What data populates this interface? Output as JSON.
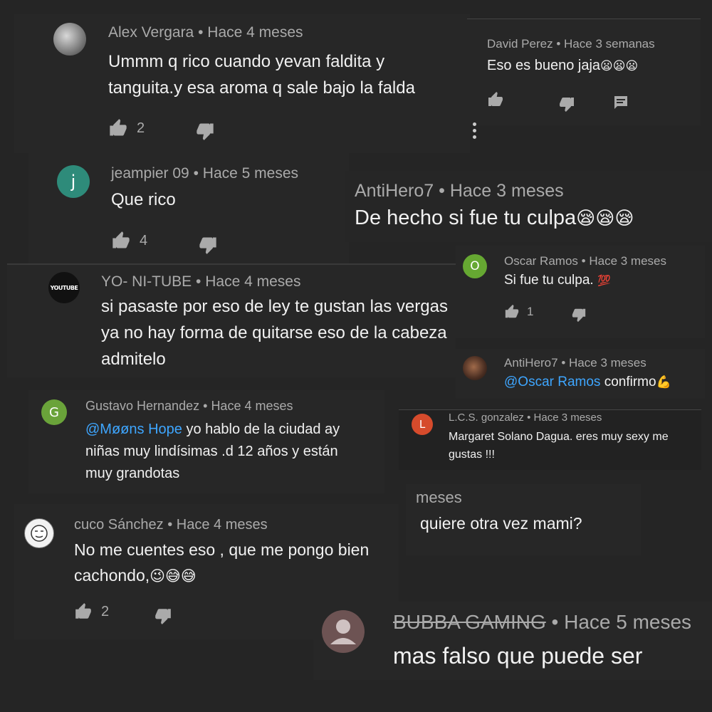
{
  "c1": {
    "author": "Alex Vergara",
    "time": "Hace 4 meses",
    "text": "Ummm q rico cuando yevan faldita y tanguita.y esa aroma q sale bajo la falda",
    "likes": "2"
  },
  "c2": {
    "author": "David Perez",
    "time": "Hace 3 semanas",
    "text": "Eso es bueno jaja",
    "emoji": "😦😦😦"
  },
  "c3": {
    "initial": "j",
    "author": "jeampier 09",
    "time": "Hace 5 meses",
    "text": "Que rico",
    "likes": "4",
    "avatar_color": "#2e8b7a"
  },
  "c4": {
    "author": "AntiHero7",
    "time": "Hace 3 meses",
    "text": "De hecho si fue tu culpa",
    "emoji": "😪😪😪"
  },
  "c5": {
    "avatar_text": "YOUTUBE",
    "author": "YO- NI-TUBE",
    "time": "Hace 4 meses",
    "text": "si pasaste por eso de ley te gustan las vergas ya no hay forma de quitarse eso de la cabeza admitelo"
  },
  "c6": {
    "initial": "O",
    "author": "Oscar Ramos",
    "time": "Hace 3 meses",
    "text": "Si fue tu culpa.",
    "emoji": "💯",
    "likes": "1",
    "avatar_color": "#66a832"
  },
  "c7": {
    "author": "AntiHero7",
    "time": "Hace 3 meses",
    "mention": "@Oscar Ramos",
    "text": " confirmo",
    "emoji": "💪"
  },
  "c8": {
    "initial": "G",
    "author": "Gustavo Hernandez",
    "time": "Hace 4 meses",
    "mention": "@Møøns Hope",
    "text": " yo hablo de la ciudad ay niñas muy lindísimas .d 12 años y están muy grandotas",
    "avatar_color": "#6aa33a"
  },
  "c9": {
    "initial": "L",
    "author": "L.C.S. gonzalez",
    "time": "Hace 3 meses",
    "text": "Margaret Solano Dagua. eres muy sexy me gustas !!!",
    "avatar_color": "#d64b2c"
  },
  "c10": {
    "time_fragment": "meses",
    "text": "quiere otra vez mami?"
  },
  "c11": {
    "author": "cuco Sánchez",
    "time": "Hace 4 meses",
    "text": "No me cuentes eso , que me pongo bien cachondo,",
    "emoji": "😉😅😅",
    "likes": "2"
  },
  "c12": {
    "author": "BUBBA GAMING",
    "time": "Hace 5 meses",
    "text": "mas falso que puede ser"
  },
  "sep": "•",
  "icons": {
    "like": "thumb-up-icon",
    "dislike": "thumb-down-icon",
    "reply": "comment-icon",
    "more": "more-vert-icon",
    "avatar": "person-avatar-icon"
  }
}
